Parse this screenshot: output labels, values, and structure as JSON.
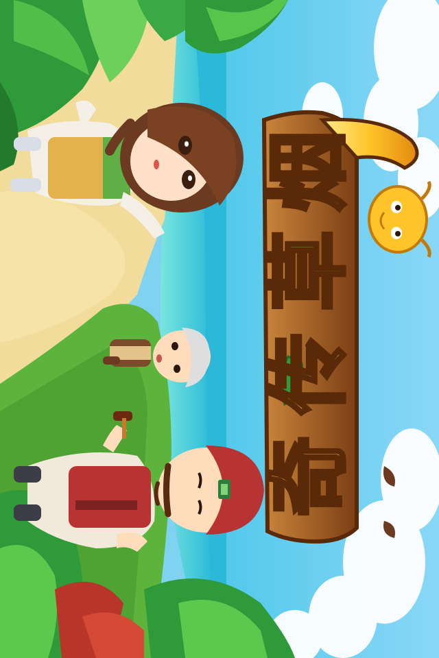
{
  "screen": "splash",
  "title": {
    "characters": [
      "烟",
      "草",
      "传",
      "奇"
    ]
  },
  "colors": {
    "sky": "#8fd6f5",
    "sea": "#35c7d8",
    "sand": "#f2dfa0",
    "grass": "#58b43c",
    "title_gold": "#ffd24a",
    "title_wood": "#8a4a1c",
    "title_outline": "#5a2a08"
  },
  "characters_in_scene": [
    {
      "role": "girl-character"
    },
    {
      "role": "boy-character"
    },
    {
      "role": "man-character"
    }
  ],
  "mascot": {
    "icon": "dragon-mascot-icon"
  }
}
